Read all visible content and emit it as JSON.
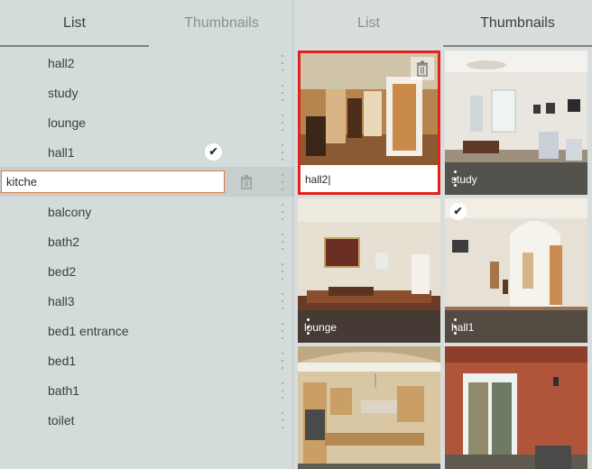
{
  "left_panel": {
    "tabs": [
      {
        "label": "List",
        "active": true
      },
      {
        "label": "Thumbnails",
        "active": false
      }
    ],
    "items_before": [
      {
        "label": "hall2"
      },
      {
        "label": "study"
      },
      {
        "label": "lounge"
      },
      {
        "label": "hall1",
        "checked": true
      }
    ],
    "edit_value": "kitche",
    "items_after": [
      {
        "label": "balcony"
      },
      {
        "label": "bath2"
      },
      {
        "label": "bed2"
      },
      {
        "label": "hall3"
      },
      {
        "label": "bed1 entrance"
      },
      {
        "label": "bed1"
      },
      {
        "label": "bath1"
      },
      {
        "label": "toilet"
      }
    ]
  },
  "right_panel": {
    "tabs": [
      {
        "label": "List",
        "active": false
      },
      {
        "label": "Thumbnails",
        "active": true
      }
    ],
    "thumbnails": [
      {
        "label": "hall2",
        "selected": true,
        "editing": true
      },
      {
        "label": "study"
      },
      {
        "label": "lounge"
      },
      {
        "label": "hall1",
        "checked": true
      },
      {
        "label": ""
      },
      {
        "label": ""
      }
    ]
  },
  "colors": {
    "selection_border": "#e0231e",
    "edit_border": "#e07a4a",
    "panel_bg": "#d3dcdb"
  }
}
